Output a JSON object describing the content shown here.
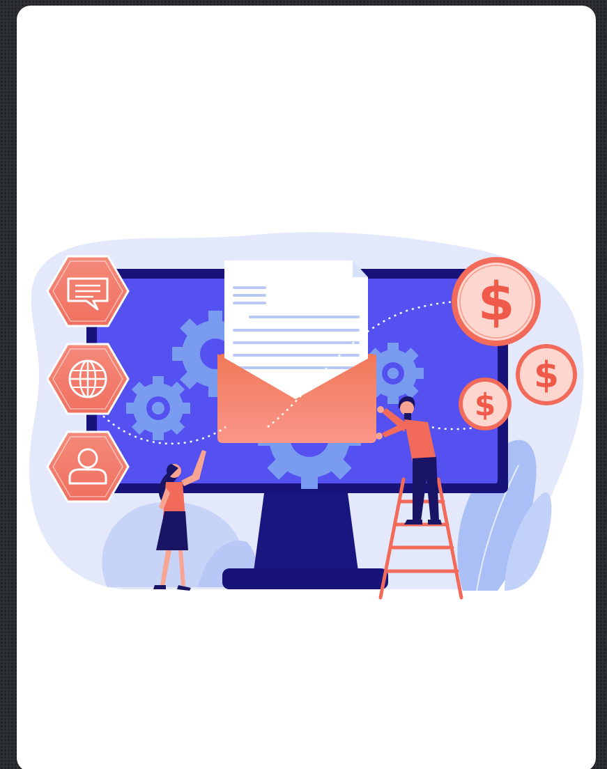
{
  "card": {
    "illustration": {
      "subject": "email-marketing",
      "icons": [
        "message-icon",
        "globe-icon",
        "user-icon",
        "envelope-icon",
        "gear-icon",
        "dollar-coin-icon"
      ],
      "currency_symbol": "$"
    }
  },
  "colors": {
    "page_background": "#2c2f33",
    "card_background": "#ffffff",
    "blob": "#e2e8fb",
    "screen": "#5350f0",
    "monitor_frame": "#17137a",
    "gear": "#7a9cf0",
    "accent": "#f26b5a",
    "hexagon": "#f58a78",
    "coin": "#fdd7cf",
    "coin_ring": "#ef6b5c"
  }
}
